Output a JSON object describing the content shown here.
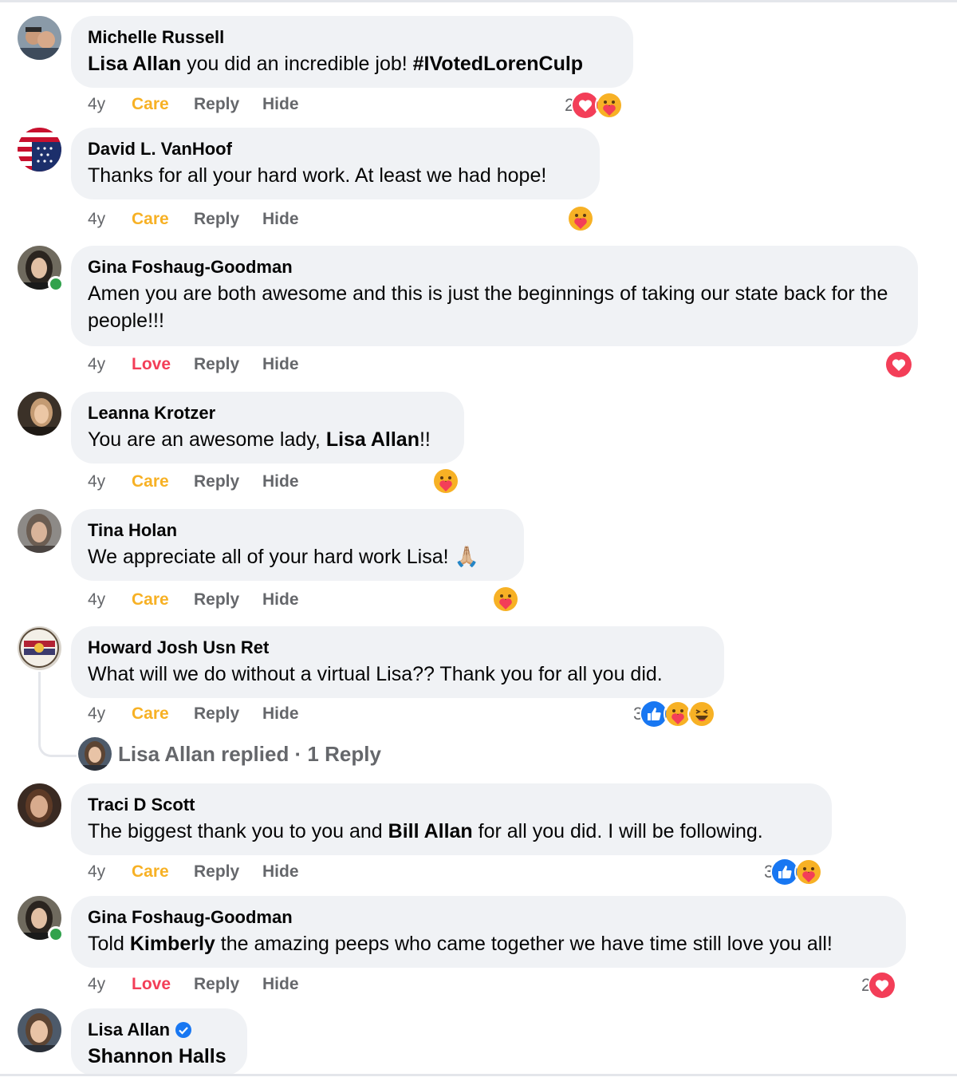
{
  "actions": {
    "time": "4y",
    "reply": "Reply",
    "hide": "Hide"
  },
  "colors": {
    "care": "#f7b125",
    "love": "#f33e58",
    "like": "#1877f2",
    "muted": "#65676b",
    "bubble": "#f0f2f5"
  },
  "comments": [
    {
      "author": "Michelle Russell",
      "parts": [
        {
          "b": "Lisa Allan"
        },
        {
          "t": " you did an incredible job! "
        },
        {
          "b": "#IVotedLorenCulp"
        }
      ],
      "reaction_label": "Care",
      "reaction_count": "2",
      "reaction_icons": [
        "heart-icon",
        "care-icon"
      ]
    },
    {
      "author": "David L. VanHoof",
      "parts": [
        {
          "t": "Thanks for all your hard work. At least we had hope!"
        }
      ],
      "reaction_label": "Care",
      "reaction_count": "",
      "reaction_icons": [
        "care-icon"
      ]
    },
    {
      "author": "Gina Foshaug-Goodman",
      "parts": [
        {
          "t": "Amen you are both awesome and this is just the beginnings of taking our state back for the people!!!"
        }
      ],
      "reaction_label": "Love",
      "reaction_count": "",
      "reaction_icons": [
        "heart-icon"
      ],
      "online": true
    },
    {
      "author": "Leanna Krotzer",
      "parts": [
        {
          "t": "You are an awesome lady, "
        },
        {
          "b": "Lisa Allan"
        },
        {
          "t": "!!"
        }
      ],
      "reaction_label": "Care",
      "reaction_count": "",
      "reaction_icons": [
        "care-icon"
      ]
    },
    {
      "author": "Tina Holan",
      "parts": [
        {
          "t": "We appreciate all of your hard work Lisa! 🙏🏼"
        }
      ],
      "reaction_label": "Care",
      "reaction_count": "",
      "reaction_icons": [
        "care-icon"
      ]
    },
    {
      "author": "Howard Josh Usn Ret",
      "parts": [
        {
          "t": "What will we do without a virtual Lisa?? Thank you for all you did."
        }
      ],
      "reaction_label": "Care",
      "reaction_count": "3",
      "reaction_icons": [
        "like-icon",
        "care-icon",
        "haha-icon"
      ]
    },
    {
      "author": "Traci D Scott",
      "parts": [
        {
          "t": "The biggest thank you to you and "
        },
        {
          "b": "Bill Allan"
        },
        {
          "t": " for all you did. I will be following."
        }
      ],
      "reaction_label": "Care",
      "reaction_count": "3",
      "reaction_icons": [
        "like-icon",
        "care-icon"
      ]
    },
    {
      "author": "Gina Foshaug-Goodman",
      "parts": [
        {
          "t": "Told "
        },
        {
          "b": "Kimberly"
        },
        {
          "t": " the amazing peeps who came together we have time still love you all!"
        }
      ],
      "reaction_label": "Love",
      "reaction_count": "2",
      "reaction_icons": [
        "heart-icon"
      ],
      "online": true
    },
    {
      "author": "Lisa Allan",
      "parts": [
        {
          "b": "Shannon Halls"
        }
      ],
      "verified": true
    }
  ],
  "replied": {
    "text": "Lisa Allan replied · 1 Reply"
  }
}
